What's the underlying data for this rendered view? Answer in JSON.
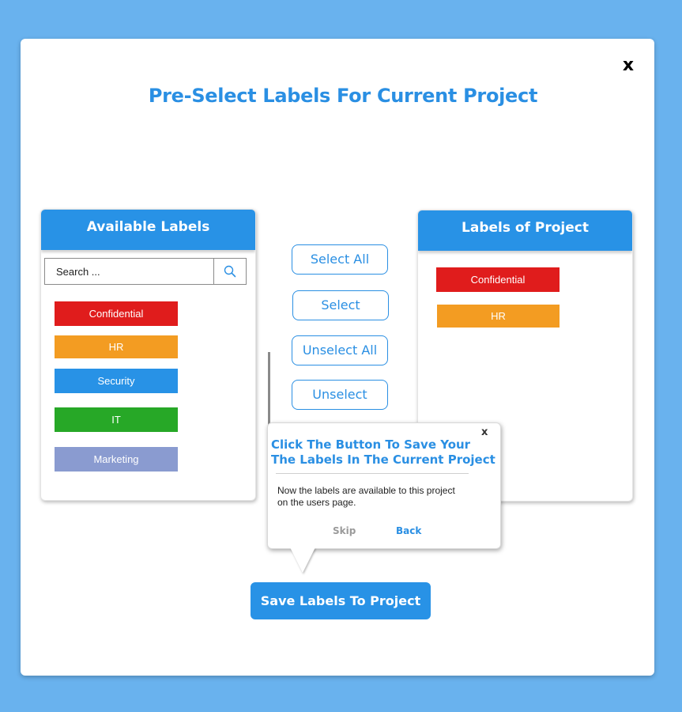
{
  "modal": {
    "close_label": "x",
    "title": "Pre-Select Labels For Current Project"
  },
  "available": {
    "header": "Available Labels",
    "search_placeholder": "Search ...",
    "labels": [
      {
        "name": "Confidential",
        "color": "#e01c1c"
      },
      {
        "name": "HR",
        "color": "#f39c22"
      },
      {
        "name": "Security",
        "color": "#2892e6"
      },
      {
        "name": "IT",
        "color": "#27a827"
      },
      {
        "name": "Marketing",
        "color": "#8a9bd0"
      }
    ]
  },
  "actions": {
    "select_all": "Select All",
    "select": "Select",
    "unselect_all": "Unselect All",
    "unselect": "Unselect"
  },
  "project": {
    "header": "Labels of Project",
    "labels": [
      {
        "name": "Confidential",
        "color": "#e01c1c"
      },
      {
        "name": "HR",
        "color": "#f39c22"
      }
    ]
  },
  "tooltip": {
    "close_label": "x",
    "title_line1": "Click The Button To Save Your",
    "title_line2": "The Labels In The Current Project",
    "body_line1": "Now the labels are available to this project",
    "body_line2": "on the users page.",
    "skip": "Skip",
    "back": "Back"
  },
  "save_button": "Save Labels To Project",
  "icons": {
    "search": "search-icon"
  }
}
